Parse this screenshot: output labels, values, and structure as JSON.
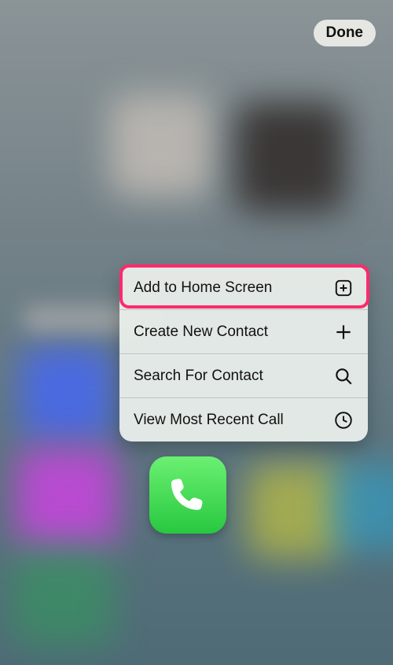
{
  "header": {
    "done_label": "Done"
  },
  "context_menu": {
    "items": [
      {
        "label": "Add to Home Screen",
        "icon": "add-box"
      },
      {
        "label": "Create New Contact",
        "icon": "plus"
      },
      {
        "label": "Search For Contact",
        "icon": "search"
      },
      {
        "label": "View Most Recent Call",
        "icon": "clock"
      }
    ],
    "highlighted_index": 0
  },
  "focused_app": {
    "name": "Phone",
    "icon": "phone"
  },
  "colors": {
    "highlight": "#ff2a6d",
    "phone_gradient_top": "#6bf072",
    "phone_gradient_bottom": "#28c840"
  }
}
